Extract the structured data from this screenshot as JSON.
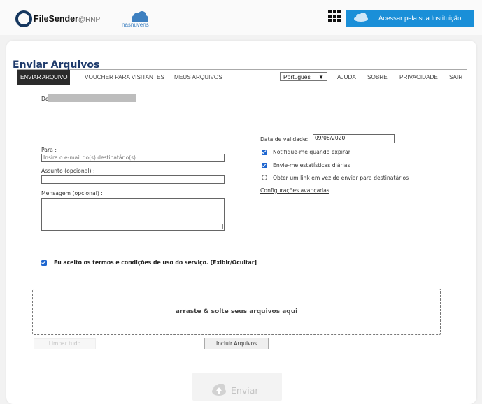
{
  "header": {
    "logo_name": "FileSender",
    "logo_suffix": "@RNP",
    "partner_logo": "nasnuvens",
    "institution_button": "Acessar pela sua Instituição",
    "institution_logo": "nasnuvens"
  },
  "nav": {
    "send": "ENVIAR ARQUIVO",
    "voucher": "VOUCHER PARA VISITANTES",
    "my_files": "MEUS ARQUIVOS",
    "language": "Português",
    "help": "AJUDA",
    "about": "SOBRE",
    "privacy": "PRIVACIDADE",
    "logout": "SAIR"
  },
  "page": {
    "title": "Enviar Arquivos"
  },
  "form": {
    "from_label": "De :",
    "to_label": "Para :",
    "to_placeholder": "Insira o e-mail do(s) destinatário(s)",
    "subject_label": "Assunto (opcional) :",
    "message_label": "Mensagem (opcional) :",
    "expiry_label": "Data de validade:",
    "expiry_value": "09/08/2020",
    "notify_label": "Notifique-me quando expirar",
    "notify_checked": true,
    "daily_stats_label": "Envie-me estatísticas diárias",
    "daily_stats_checked": true,
    "get_link_label": "Obter um link em vez de enviar para destinatários",
    "get_link_checked": false,
    "advanced_settings": "Configurações avançadas",
    "terms_label": "Eu aceito os termos e condições de uso do serviço.",
    "terms_toggle": "[Exibir/Ocultar]",
    "terms_checked": true
  },
  "upload": {
    "dropzone_text": "arraste & solte seus arquivos aqui",
    "clear_all": "Limpar tudo",
    "include_files": "Incluir Arquivos",
    "send": "Enviar"
  },
  "colors": {
    "brand_navy": "#16375f",
    "title_blue": "#1e3a6b",
    "accent_blue": "#1a8fd8",
    "checkbox_blue": "#1e66d0",
    "nav_active_bg": "#2b2b2b"
  }
}
